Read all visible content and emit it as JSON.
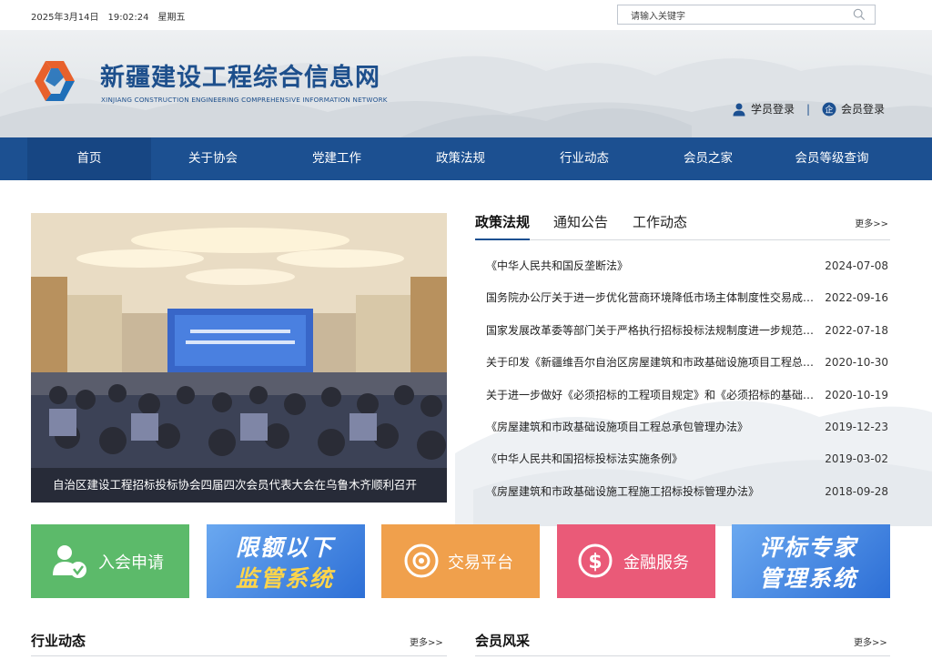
{
  "topbar": {
    "date": "2025年3月14日",
    "time": "19:02:24",
    "weekday": "星期五",
    "search_placeholder": "请输入关键字",
    "search_icon": "search-icon"
  },
  "header": {
    "title": "新疆建设工程综合信息网",
    "subtitle": "XINJIANG CONSTRUCTION ENGINEERING COMPREHENSIVE INFORMATION NETWORK",
    "student_login": "学员登录",
    "member_login": "会员登录",
    "separator": "|"
  },
  "nav": {
    "items": [
      "首页",
      "关于协会",
      "党建工作",
      "政策法规",
      "行业动态",
      "会员之家",
      "会员等级查询"
    ],
    "active_index": 0
  },
  "slider": {
    "caption": "自治区建设工程招标投标协会四届四次会员代表大会在乌鲁木齐顺利召开"
  },
  "news": {
    "tabs": [
      "政策法规",
      "通知公告",
      "工作动态"
    ],
    "active_tab": 0,
    "more": "更多>>",
    "items": [
      {
        "title": "《中华人民共和国反垄断法》",
        "date": "2024-07-08"
      },
      {
        "title": "国务院办公厅关于进一步优化营商环境降低市场主体制度性交易成本的意见",
        "date": "2022-09-16"
      },
      {
        "title": "国家发展改革委等部门关于严格执行招标投标法规制度进一步规范招标投标主体行为的若干意见",
        "date": "2022-07-18"
      },
      {
        "title": "关于印发《新疆维吾尔自治区房屋建筑和市政基础设施项目工程总承包管理办法》的通知",
        "date": "2020-10-30"
      },
      {
        "title": "关于进一步做好《必须招标的工程项目规定》和《必须招标的基础设施和公用事业项目范围规定》实施工作的通知",
        "date": "2020-10-19"
      },
      {
        "title": "《房屋建筑和市政基础设施项目工程总承包管理办法》",
        "date": "2019-12-23"
      },
      {
        "title": "《中华人民共和国招标投标法实施条例》",
        "date": "2019-03-02"
      },
      {
        "title": "《房屋建筑和市政基础设施工程施工招标投标管理办法》",
        "date": "2018-09-28"
      }
    ]
  },
  "quick": {
    "join": "入会申请",
    "supervise_line1": "限额以下",
    "supervise_line2": "监管系统",
    "trade": "交易平台",
    "finance": "金融服务",
    "expert_line1": "评标专家",
    "expert_line2": "管理系统",
    "colors": {
      "join": "#5cba6a",
      "supervise": "#3c7ee0",
      "trade": "#f0a04c",
      "finance": "#ea5a78",
      "expert": "#3c7ee0"
    }
  },
  "sections": {
    "industry": "行业动态",
    "members": "会员风采",
    "more": "更多>>"
  },
  "colors": {
    "primary": "#1c5091",
    "nav_active": "#174683"
  }
}
